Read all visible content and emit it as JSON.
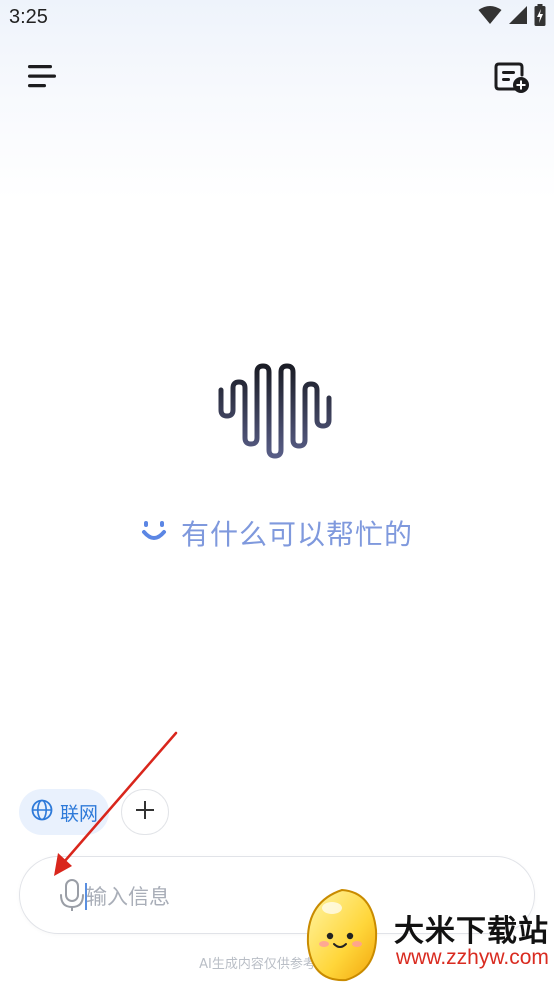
{
  "status_bar": {
    "time": "3:25",
    "icons": [
      "wifi-icon",
      "cell-signal-icon",
      "battery-icon"
    ]
  },
  "header": {
    "menu_icon": "hamburger-menu-icon",
    "new_chat_icon": "new-chat-icon"
  },
  "main": {
    "logo_icon": "waveform-logo",
    "greeting_icon": "smile-icon",
    "greeting": "有什么可以帮忙的"
  },
  "chips": [
    {
      "label": "联网",
      "icon": "globe-icon"
    },
    {
      "label": "",
      "icon": "plus-icon"
    }
  ],
  "input": {
    "placeholder": "输入信息",
    "value": "",
    "mic_icon": "microphone-icon"
  },
  "disclaimer": "AI生成内容仅供参考，重要",
  "watermark": {
    "title": "大米下载站",
    "url": "www.zzhyw.com"
  },
  "colors": {
    "accent": "#2e7ad9",
    "greeting": "#7f99dd",
    "annotation_arrow": "#d9261c",
    "watermark_url": "#d92b20"
  }
}
